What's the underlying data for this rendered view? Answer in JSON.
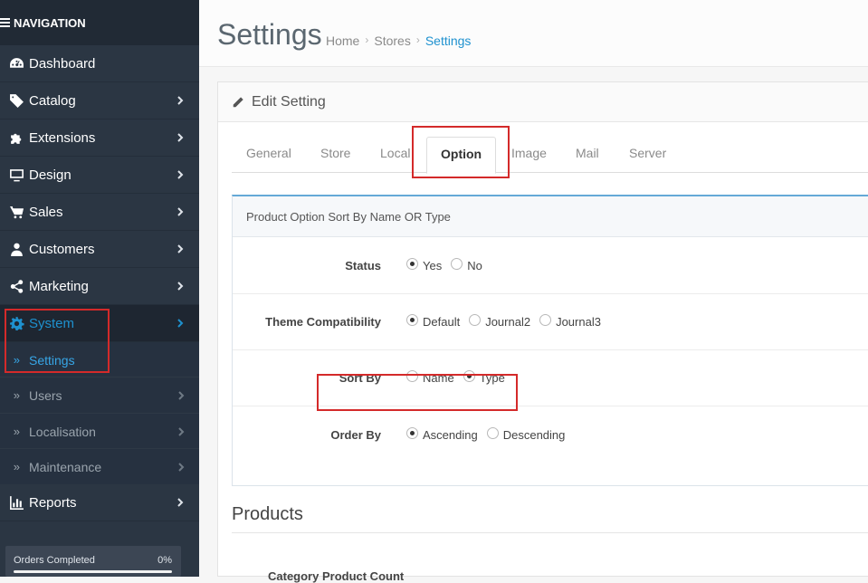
{
  "sidebar": {
    "header": "NAVIGATION",
    "items": [
      {
        "label": "Dashboard",
        "icon": "dashboard-icon"
      },
      {
        "label": "Catalog",
        "icon": "tags-icon"
      },
      {
        "label": "Extensions",
        "icon": "puzzle-icon"
      },
      {
        "label": "Design",
        "icon": "desktop-icon"
      },
      {
        "label": "Sales",
        "icon": "cart-icon"
      },
      {
        "label": "Customers",
        "icon": "user-icon"
      },
      {
        "label": "Marketing",
        "icon": "share-icon"
      },
      {
        "label": "System",
        "icon": "gear-icon"
      },
      {
        "label": "Reports",
        "icon": "bar-chart-icon"
      }
    ],
    "submenu": [
      {
        "label": "Settings"
      },
      {
        "label": "Users"
      },
      {
        "label": "Localisation"
      },
      {
        "label": "Maintenance"
      }
    ],
    "orders": {
      "label": "Orders Completed",
      "value": "0%"
    }
  },
  "header": {
    "title": "Settings",
    "breadcrumb": [
      "Home",
      "Stores",
      "Settings"
    ]
  },
  "panel": {
    "title": "Edit Setting",
    "tabs": [
      "General",
      "Store",
      "Local",
      "Option",
      "Image",
      "Mail",
      "Server"
    ],
    "active_tab": "Option"
  },
  "section": {
    "heading": "Product Option Sort By Name OR Type",
    "rows": [
      {
        "label": "Status",
        "options": [
          "Yes",
          "No"
        ],
        "selected": "Yes"
      },
      {
        "label": "Theme Compatibility",
        "options": [
          "Default",
          "Journal2",
          "Journal3"
        ],
        "selected": "Default"
      },
      {
        "label": "Sort By",
        "options": [
          "Name",
          "Type"
        ],
        "selected": "Type"
      },
      {
        "label": "Order By",
        "options": [
          "Ascending",
          "Descending"
        ],
        "selected": "Ascending"
      }
    ]
  },
  "products": {
    "title": "Products",
    "partial_row_label": "Category Product Count"
  },
  "colors": {
    "sidebar_bg": "#2b3643",
    "accent": "#1e91cf",
    "highlight": "#d42a2a"
  }
}
